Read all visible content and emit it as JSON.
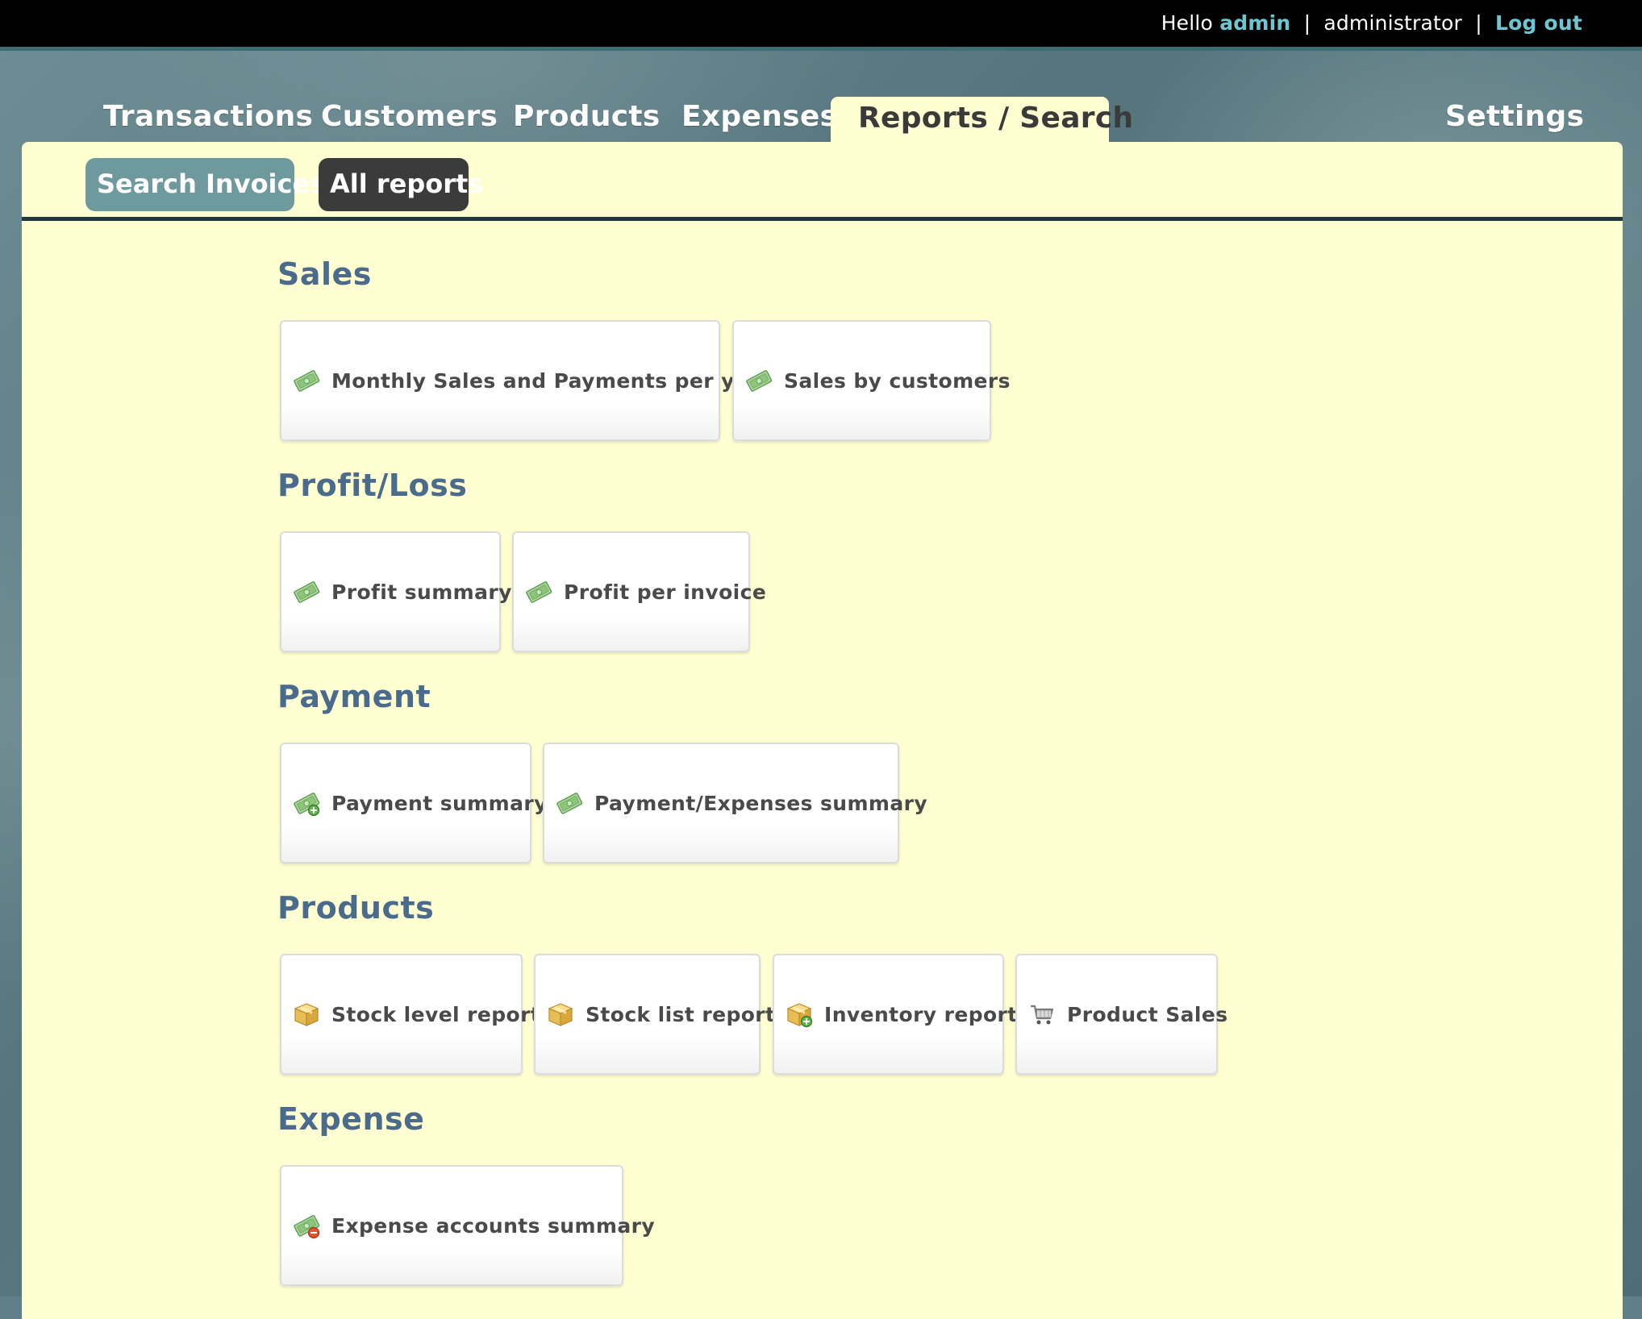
{
  "header": {
    "greeting": "Hello",
    "username": "admin",
    "separator": "|",
    "role": "administrator",
    "logout_label": "Log out"
  },
  "nav": {
    "transactions": "Transactions",
    "customers": "Customers",
    "products": "Products",
    "expenses": "Expenses",
    "reports": "Reports / Search",
    "settings": "Settings",
    "active_tab": "Reports / Search"
  },
  "subnav": {
    "search_invoices": "Search Invoices",
    "all_reports": "All reports",
    "active": "All reports"
  },
  "sections": {
    "sales": {
      "title": "Sales",
      "reports": [
        {
          "label": "Monthly Sales and Payments per year",
          "icon": "money-icon"
        },
        {
          "label": "Sales by customers",
          "icon": "money-icon"
        }
      ]
    },
    "profit": {
      "title": "Profit/Loss",
      "reports": [
        {
          "label": "Profit summary",
          "icon": "money-icon"
        },
        {
          "label": "Profit per invoice",
          "icon": "money-icon"
        }
      ]
    },
    "payment": {
      "title": "Payment",
      "reports": [
        {
          "label": "Payment summary",
          "icon": "money-add-icon"
        },
        {
          "label": "Payment/Expenses summary",
          "icon": "money-icon"
        }
      ]
    },
    "products": {
      "title": "Products",
      "reports": [
        {
          "label": "Stock level report",
          "icon": "package-icon"
        },
        {
          "label": "Stock list report",
          "icon": "package-icon"
        },
        {
          "label": "Inventory report",
          "icon": "package-add-icon"
        },
        {
          "label": "Product Sales",
          "icon": "cart-icon"
        }
      ]
    },
    "expense": {
      "title": "Expense",
      "reports": [
        {
          "label": "Expense accounts summary",
          "icon": "money-delete-icon"
        }
      ]
    }
  },
  "colors": {
    "panel_bg": "#ffffd2",
    "section_title": "#4a6b8c",
    "link": "#6fc6d3",
    "subtab_search": "#6f9a9d",
    "subtab_active": "#3b3b3b"
  }
}
